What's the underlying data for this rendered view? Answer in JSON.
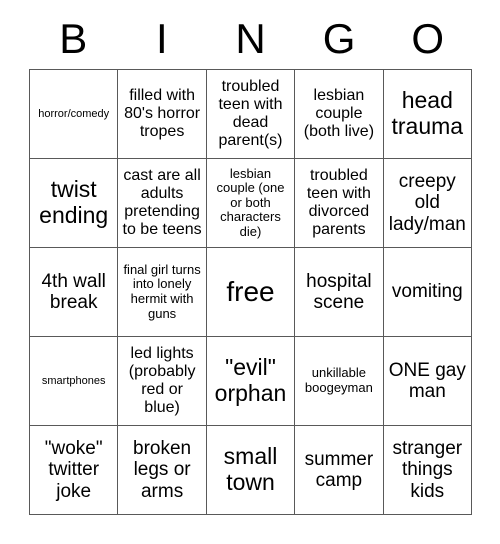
{
  "card": {
    "title_letters": [
      "B",
      "I",
      "N",
      "G",
      "O"
    ],
    "grid": {
      "columns": 5,
      "rows": 5,
      "cells": [
        {
          "text": "horror/comedy",
          "size": "xs"
        },
        {
          "text": "filled with 80's horror tropes",
          "size": "m"
        },
        {
          "text": "troubled teen with dead parent(s)",
          "size": "m"
        },
        {
          "text": "lesbian couple (both live)",
          "size": "m"
        },
        {
          "text": "head trauma",
          "size": "xl"
        },
        {
          "text": "twist ending",
          "size": "xl"
        },
        {
          "text": "cast are all adults pretending to be teens",
          "size": "m"
        },
        {
          "text": "lesbian couple (one or both characters die)",
          "size": "s"
        },
        {
          "text": "troubled teen with divorced parents",
          "size": "m"
        },
        {
          "text": "creepy old lady/man",
          "size": "l"
        },
        {
          "text": "4th wall break",
          "size": "l"
        },
        {
          "text": "final girl turns into lonely hermit with guns",
          "size": "s"
        },
        {
          "text": "free",
          "size": "xxl"
        },
        {
          "text": "hospital scene",
          "size": "l"
        },
        {
          "text": "vomiting",
          "size": "l"
        },
        {
          "text": "smartphones",
          "size": "xs"
        },
        {
          "text": "led lights (probably red or blue)",
          "size": "m"
        },
        {
          "text": "\"evil\" orphan",
          "size": "xl"
        },
        {
          "text": "unkillable boogeyman",
          "size": "s"
        },
        {
          "text": "ONE gay man",
          "size": "l"
        },
        {
          "text": "\"woke\" twitter joke",
          "size": "l"
        },
        {
          "text": "broken legs or arms",
          "size": "l"
        },
        {
          "text": "small town",
          "size": "xl"
        },
        {
          "text": "summer camp",
          "size": "l"
        },
        {
          "text": "stranger things kids",
          "size": "l"
        }
      ]
    },
    "colors": {
      "background": "#ffffff",
      "text": "#000000",
      "grid_line": "#595959"
    }
  }
}
